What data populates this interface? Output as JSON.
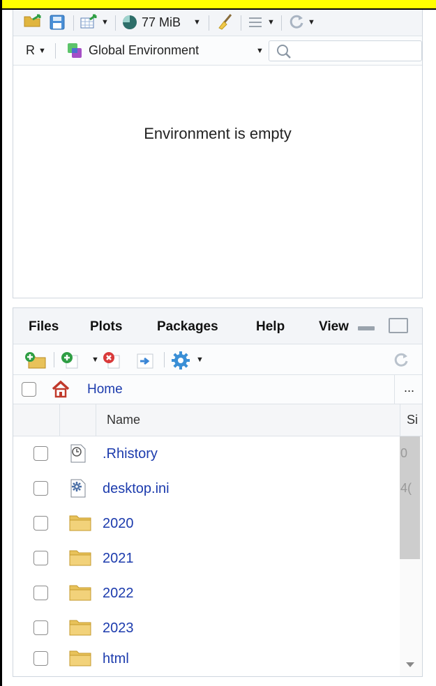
{
  "environment_pane": {
    "memory_label": "77 MiB",
    "language_label": "R",
    "scope_label": "Global Environment",
    "search_placeholder": "",
    "empty_message": "Environment is empty"
  },
  "files_pane": {
    "tabs": [
      {
        "label": "Files"
      },
      {
        "label": "Plots"
      },
      {
        "label": "Packages"
      },
      {
        "label": "Help"
      },
      {
        "label": "View"
      }
    ],
    "breadcrumb": {
      "home_label": "Home",
      "more_label": "..."
    },
    "columns": {
      "name": "Name",
      "size": "Si"
    },
    "files": [
      {
        "name": ".Rhistory",
        "icon": "history-file-icon",
        "size": "0"
      },
      {
        "name": "desktop.ini",
        "icon": "settings-file-icon",
        "size": "4("
      },
      {
        "name": "2020",
        "icon": "folder-icon",
        "size": ""
      },
      {
        "name": "2021",
        "icon": "folder-icon",
        "size": ""
      },
      {
        "name": "2022",
        "icon": "folder-icon",
        "size": ""
      },
      {
        "name": "2023",
        "icon": "folder-icon",
        "size": ""
      },
      {
        "name": "html",
        "icon": "folder-icon",
        "size": ""
      }
    ]
  },
  "colors": {
    "banner": "#ffff00",
    "link": "#1c3bad",
    "pane_header": "#f3f5f8",
    "folder": "#e8c25a"
  }
}
